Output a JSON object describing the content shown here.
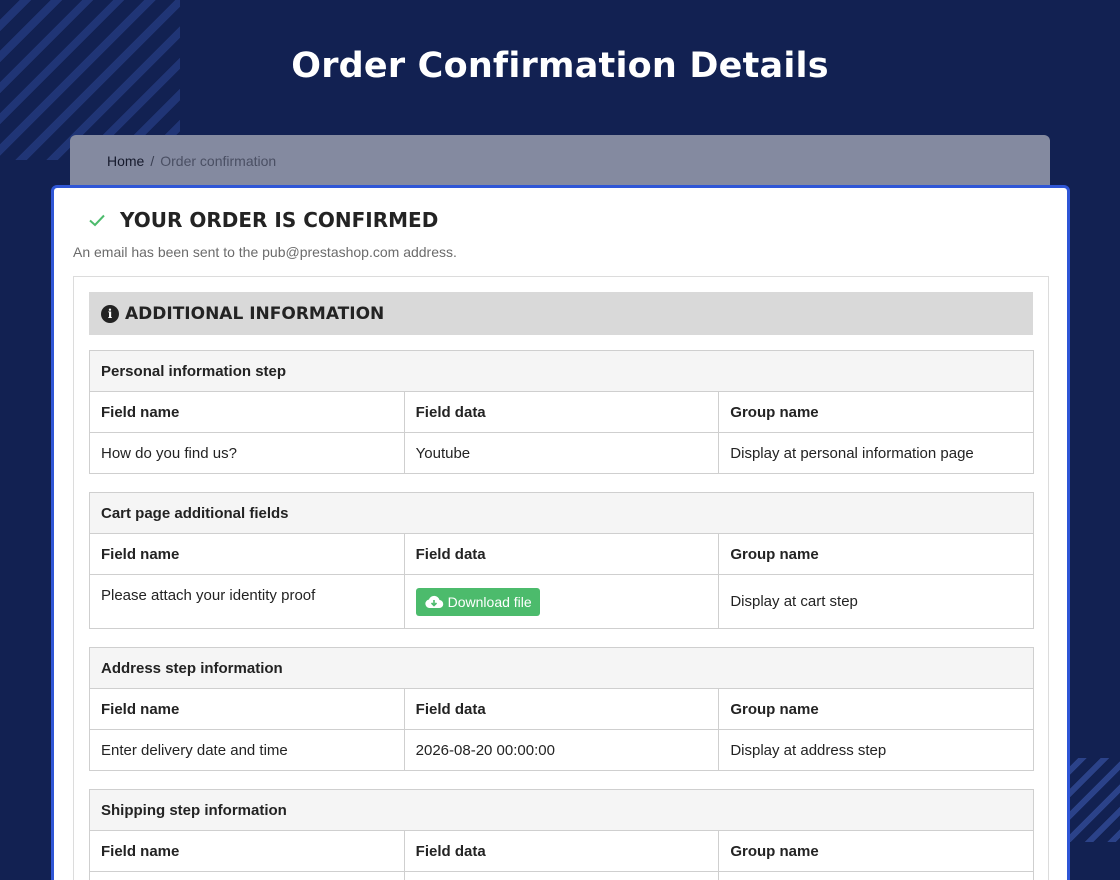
{
  "page": {
    "title": "Order Confirmation Details"
  },
  "breadcrumb": {
    "home": "Home",
    "separator": "/",
    "current": "Order confirmation"
  },
  "confirmation": {
    "title": "YOUR ORDER IS CONFIRMED",
    "subtitle": "An email has been sent to the pub@prestashop.com address."
  },
  "additional_info": {
    "title": "ADDITIONAL INFORMATION",
    "sections": [
      {
        "name": "Personal information step",
        "headers": [
          "Field name",
          "Field data",
          "Group name"
        ],
        "rows": [
          [
            "How do you find us?",
            "Youtube",
            "Display at personal information page"
          ]
        ]
      },
      {
        "name": "Cart page additional fields",
        "headers": [
          "Field name",
          "Field data",
          "Group name"
        ],
        "rows": [
          [
            "Please attach your identity proof",
            "Download file",
            "Display at cart step"
          ]
        ]
      },
      {
        "name": "Address step information",
        "headers": [
          "Field name",
          "Field data",
          "Group name"
        ],
        "rows": [
          [
            "Enter delivery date and time",
            "2026-08-20 00:00:00",
            "Display at address step"
          ]
        ]
      },
      {
        "name": "Shipping step information",
        "headers": [
          "Field name",
          "Field data",
          "Group name"
        ]
      }
    ]
  },
  "colors": {
    "background": "#122152",
    "card_border": "#2f56d6",
    "check": "#4cbb6c",
    "download_button": "#4cbb6c"
  }
}
